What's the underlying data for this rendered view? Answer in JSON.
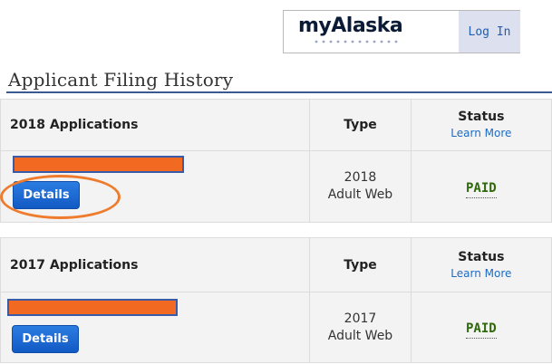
{
  "header": {
    "logo_text": "myAlaska",
    "login_label": "Log In"
  },
  "page": {
    "title": "Applicant Filing History"
  },
  "columns": {
    "type": "Type",
    "status": "Status",
    "learn_more": "Learn More"
  },
  "applications": [
    {
      "heading": "2018 Applications",
      "type_year": "2018",
      "type_kind": "Adult Web",
      "status": "PAID",
      "details_label": "Details"
    },
    {
      "heading": "2017 Applications",
      "type_year": "2017",
      "type_kind": "Adult Web",
      "status": "PAID",
      "details_label": "Details"
    }
  ],
  "colors": {
    "accent": "#1259c4",
    "redaction": "#f26a21",
    "annotation": "#ef7b2c",
    "paid": "#2f6a0a"
  }
}
